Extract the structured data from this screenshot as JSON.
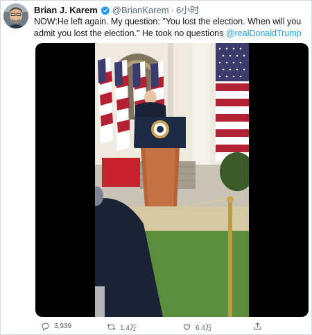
{
  "tweet": {
    "display_name": "Brian J. Karem",
    "handle": "@BrianKarem",
    "separator": "·",
    "time": "6小时",
    "text": "NOW:He left again. My question: \"You lost the election. When will you admit you lost the election.\" He took no questions ",
    "mention": "@realDonaldTrump",
    "verified": true,
    "avatar_icon": "profile-avatar",
    "media_description": "video"
  },
  "actions": {
    "reply": {
      "icon": "reply-icon",
      "count": "3,939"
    },
    "retweet": {
      "icon": "retweet-icon",
      "count": "1.4万"
    },
    "like": {
      "icon": "heart-icon",
      "count": "6.4万"
    },
    "share": {
      "icon": "share-icon"
    }
  },
  "colors": {
    "accent": "#1d9bf0",
    "text_primary": "#0f1419",
    "text_secondary": "#536471",
    "border": "#cfd9de",
    "media_bg": "#000000"
  }
}
